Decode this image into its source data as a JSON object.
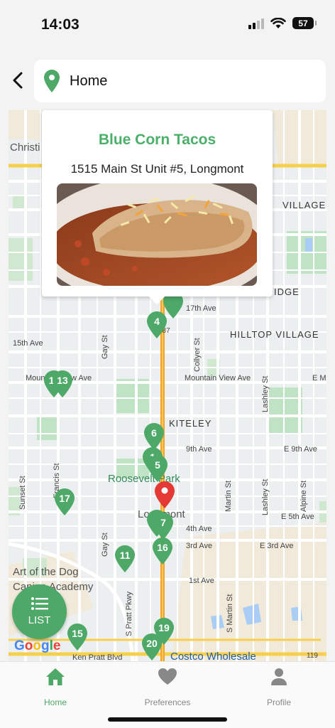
{
  "status_bar": {
    "time": "14:03",
    "battery": "57"
  },
  "search": {
    "location": "Home"
  },
  "popup": {
    "name": "Blue Corn Tacos",
    "address": "1515 Main St Unit #5, Longmont"
  },
  "map": {
    "labels": {
      "christ": "Christi",
      "village": "VILLAGE",
      "idge": "IDGE",
      "ave17": "17th Ave",
      "hilltop": "HILLTOP VILLAGE",
      "ave15": "15th Ave",
      "gay_st": "Gay St",
      "collyer": "Collyer St",
      "mountain_left": "Mountain View Ave",
      "mountain_right": "Mountain View Ave",
      "e_m": "E M",
      "lashley": "Lashley St",
      "kiteley": "KITELEY",
      "ave9": "9th Ave",
      "e9": "E 9th Ave",
      "roosevelt": "Roosevelt Park",
      "sunset": "Sunset St",
      "francis": "Francis St",
      "martin": "Martin St",
      "lashley2": "Lashley St",
      "alpine": "Alpine St",
      "longmont": "Longmont",
      "ave4": "4th Ave",
      "e5": "E 5th Ave",
      "ave3": "3rd Ave",
      "e3": "E 3rd Ave",
      "gay_st2": "Gay St",
      "art_dog": "Art of the Dog",
      "canine_academy": "Canine Academy",
      "ave1": "1st Ave",
      "s_pratt": "S Pratt Pkwy",
      "s_martin": "S Martin St",
      "ken_pratt": "Ken Pratt Blvd",
      "costco": "Costco Wholesale",
      "hwy119": "119",
      "hwy287": "287"
    },
    "markers": [
      "4",
      "11",
      "13",
      "6",
      "1",
      "5",
      "17",
      "7",
      "16",
      "11",
      "15",
      "19",
      "20"
    ]
  },
  "list_button": {
    "label": "LIST"
  },
  "google": "Google",
  "nav": {
    "home": "Home",
    "preferences": "Preferences",
    "profile": "Profile"
  },
  "colors": {
    "accent": "#4ea867",
    "title": "#4caf6a",
    "selected_marker": "#e53935"
  }
}
